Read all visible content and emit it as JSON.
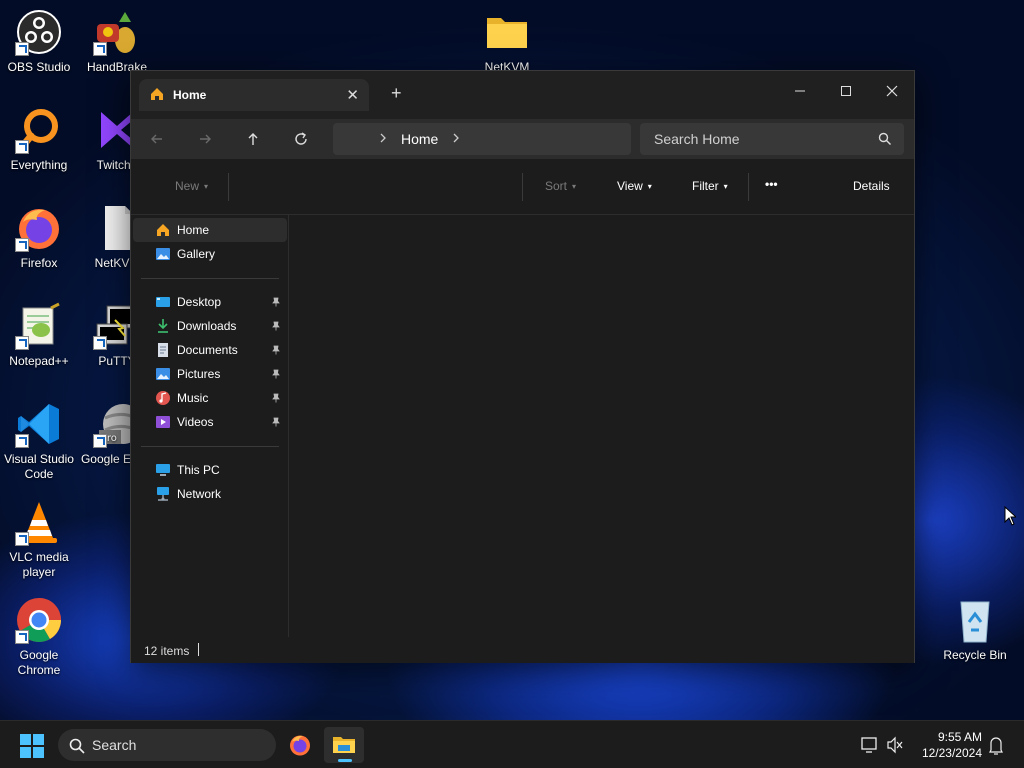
{
  "desktop": {
    "icons": [
      {
        "label": "OBS Studio"
      },
      {
        "label": "HandBrake"
      },
      {
        "label": "NetKVM"
      },
      {
        "label": "Everything"
      },
      {
        "label": "TwitchL"
      },
      {
        "label": "Firefox"
      },
      {
        "label": "NetKVM"
      },
      {
        "label": "Notepad++"
      },
      {
        "label": "PuTTY"
      },
      {
        "label": "Visual Studio Code"
      },
      {
        "label": "Google E Pro"
      },
      {
        "label": "VLC media player"
      },
      {
        "label": "Google Chrome"
      },
      {
        "label": "Recycle Bin"
      }
    ]
  },
  "explorer": {
    "tab": {
      "label": "Home"
    },
    "breadcrumb": {
      "current": "Home"
    },
    "search": {
      "placeholder": "Search Home"
    },
    "commands": {
      "new": "New",
      "sort": "Sort",
      "view": "View",
      "filter": "Filter",
      "more": "•••",
      "details": "Details"
    },
    "nav": {
      "items": [
        {
          "label": "Home"
        },
        {
          "label": "Gallery"
        },
        {
          "label": "Desktop"
        },
        {
          "label": "Downloads"
        },
        {
          "label": "Documents"
        },
        {
          "label": "Pictures"
        },
        {
          "label": "Music"
        },
        {
          "label": "Videos"
        },
        {
          "label": "This PC"
        },
        {
          "label": "Network"
        }
      ]
    },
    "status": {
      "items": "12 items"
    }
  },
  "taskbar": {
    "search_placeholder": "Search",
    "time": "9:55 AM",
    "date": "12/23/2024"
  },
  "colors": {
    "accent": "#4cc2ff",
    "window_bg": "#1c1c1c",
    "titlebar_bg": "#202020",
    "address_bg": "#2c2c2c"
  }
}
